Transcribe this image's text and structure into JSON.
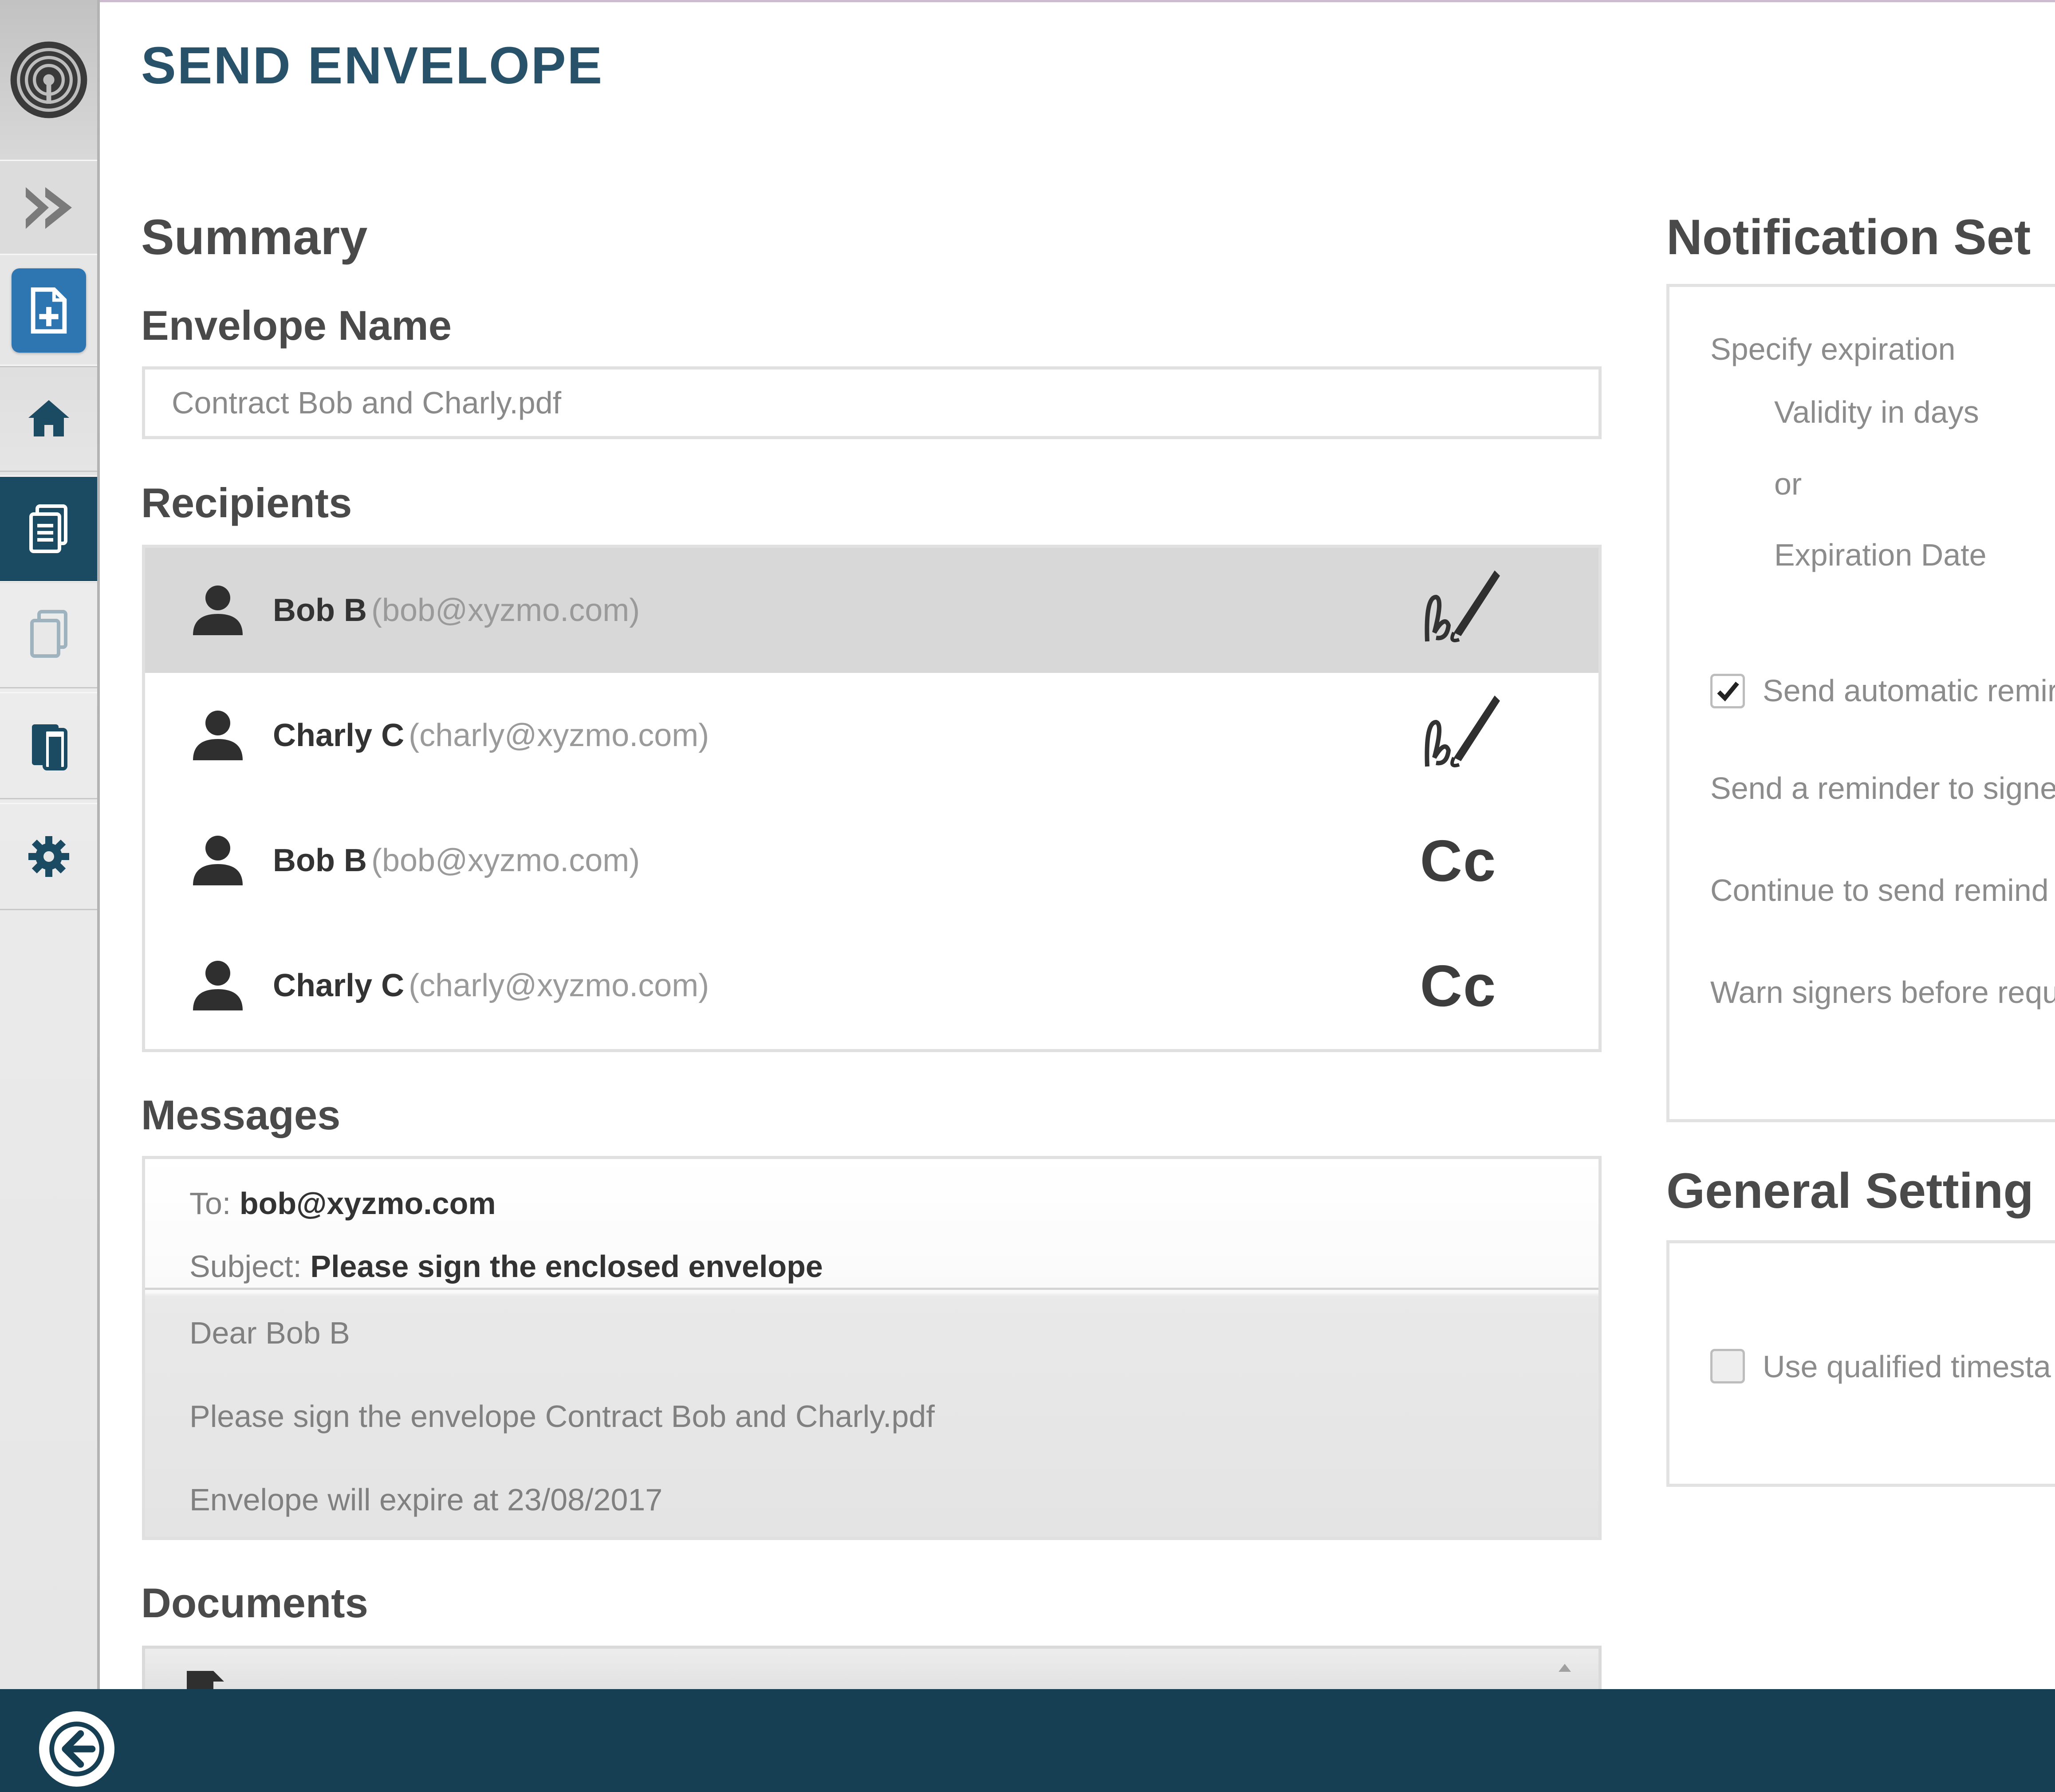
{
  "page": {
    "title": "SEND ENVELOPE"
  },
  "sidebar": {
    "items": [
      {
        "name": "expand",
        "icon": "double-chevron-right-icon"
      },
      {
        "name": "new-envelope",
        "icon": "new-document-icon"
      },
      {
        "name": "home",
        "icon": "home-icon"
      },
      {
        "name": "envelopes",
        "icon": "envelopes-icon"
      },
      {
        "name": "documents",
        "icon": "documents-icon"
      },
      {
        "name": "templates",
        "icon": "templates-icon"
      },
      {
        "name": "settings",
        "icon": "gear-icon"
      }
    ],
    "active_color": "#1b4a63",
    "new_button_color": "#2e76b2"
  },
  "summary": {
    "heading": "Summary",
    "envelope_name_label": "Envelope Name",
    "envelope_name_value": "Contract Bob and Charly.pdf",
    "recipients_label": "Recipients",
    "recipients": [
      {
        "name": "Bob B",
        "email": "(bob@xyzmo.com)",
        "role": "signer",
        "role_icon": "signature-pen-icon"
      },
      {
        "name": "Charly C",
        "email": "(charly@xyzmo.com)",
        "role": "signer",
        "role_icon": "signature-pen-icon"
      },
      {
        "name": "Bob B",
        "email": "(bob@xyzmo.com)",
        "role": "cc",
        "role_label": "Cc"
      },
      {
        "name": "Charly C",
        "email": "(charly@xyzmo.com)",
        "role": "cc",
        "role_label": "Cc"
      }
    ],
    "messages_label": "Messages",
    "message": {
      "to_label": "To:",
      "to_value": "bob@xyzmo.com",
      "subject_label": "Subject:",
      "subject_value": "Please sign the enclosed envelope",
      "greeting": "Dear Bob B",
      "body": "Please sign the envelope Contract Bob and Charly.pdf",
      "expiry": "Envelope will expire at 23/08/2017"
    },
    "documents_label": "Documents"
  },
  "notification_settings": {
    "heading": "Notification Set",
    "specify_expiration": "Specify expiration",
    "validity_in_days": "Validity in days",
    "or": "or",
    "expiration_date": "Expiration Date",
    "send_automatic_reminders": "Send automatic remir",
    "send_automatic_reminders_checked": true,
    "send_reminder_to_signers": "Send a reminder to signe",
    "continue_to_send": "Continue to send remind",
    "warn_signers": "Warn signers before requ"
  },
  "general_settings": {
    "heading": "General Setting",
    "use_qualified_timestamp": "Use qualified timesta",
    "use_qualified_timestamp_checked": false
  },
  "footer": {
    "back_icon": "back-arrow-icon",
    "bar_color": "#173f54"
  }
}
